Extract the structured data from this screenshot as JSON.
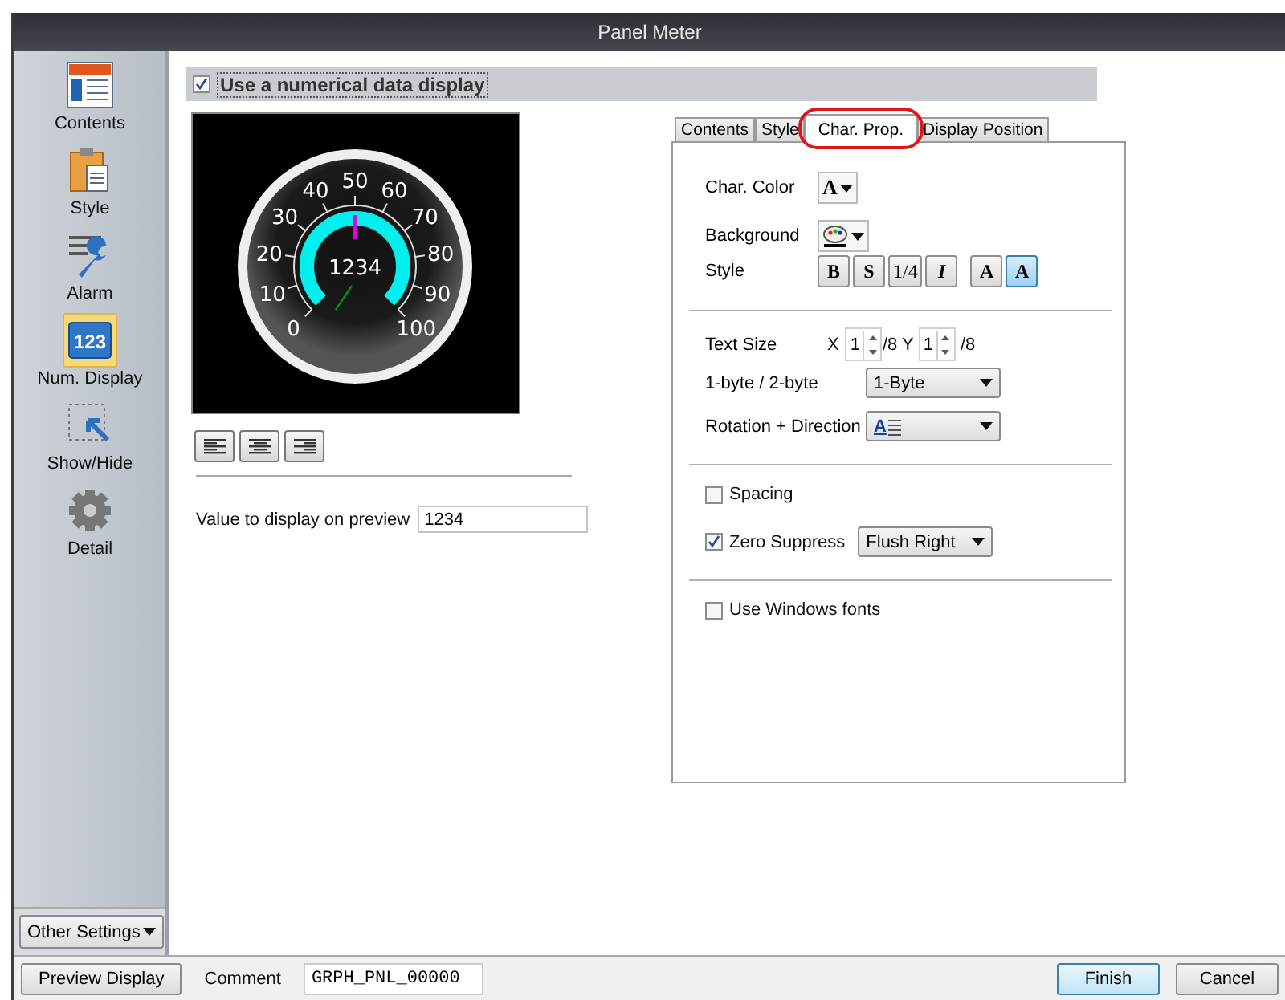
{
  "window": {
    "title": "Panel Meter"
  },
  "sidebar": {
    "items": [
      {
        "label": "Contents",
        "kind": "contents",
        "selected": false
      },
      {
        "label": "Style",
        "kind": "style",
        "selected": false
      },
      {
        "label": "Alarm",
        "kind": "alarm",
        "selected": false
      },
      {
        "label": "Num. Display",
        "kind": "numdisplay",
        "icon_text": "123",
        "selected": true
      },
      {
        "label": "Show/Hide",
        "kind": "showhide",
        "selected": false
      },
      {
        "label": "Detail",
        "kind": "detail",
        "selected": false
      }
    ],
    "other_settings": "Other Settings"
  },
  "numerical_display": {
    "label": "Use a numerical data display",
    "checked": true
  },
  "preview": {
    "value": "1234",
    "scale_labels": [
      "0",
      "10",
      "20",
      "30",
      "40",
      "50",
      "60",
      "70",
      "80",
      "90",
      "100"
    ]
  },
  "preview_value": {
    "label": "Value to display on preview",
    "value": "1234"
  },
  "tabs": [
    {
      "label": "Contents",
      "selected": false
    },
    {
      "label": "Style",
      "selected": false
    },
    {
      "label": "Char. Prop.",
      "selected": true
    },
    {
      "label": "Display Position",
      "selected": false
    }
  ],
  "char_prop": {
    "char_color": {
      "label": "Char. Color",
      "glyph": "A"
    },
    "background": {
      "label": "Background"
    },
    "style": {
      "label": "Style",
      "buttons": [
        {
          "kind": "bold",
          "text": "B",
          "selected": false
        },
        {
          "kind": "shadow",
          "text": "S",
          "selected": false
        },
        {
          "kind": "quarter",
          "text": "1/4",
          "selected": false
        },
        {
          "kind": "italic",
          "text": "I",
          "selected": false
        },
        {
          "kind": "plain",
          "text": "A",
          "selected": false
        },
        {
          "kind": "outline",
          "text": "A",
          "selected": true
        }
      ]
    },
    "text_size": {
      "label": "Text Size",
      "x_label": "X",
      "x_value": "1",
      "x_suffix": "/8 Y",
      "y_value": "1",
      "y_suffix": "/8"
    },
    "byte": {
      "label": "1-byte / 2-byte",
      "value": "1-Byte"
    },
    "rotation": {
      "label": "Rotation + Direction",
      "glyph": "A"
    },
    "spacing": {
      "label": "Spacing",
      "checked": false
    },
    "zero_suppress": {
      "label": "Zero Suppress",
      "checked": true,
      "value": "Flush Right"
    },
    "windows_fonts": {
      "label": "Use Windows fonts",
      "checked": false
    }
  },
  "footer": {
    "preview_button": "Preview Display",
    "comment_label": "Comment",
    "comment": "GRPH_PNL_00000",
    "buttons": [
      "Finish",
      "Cancel"
    ]
  }
}
